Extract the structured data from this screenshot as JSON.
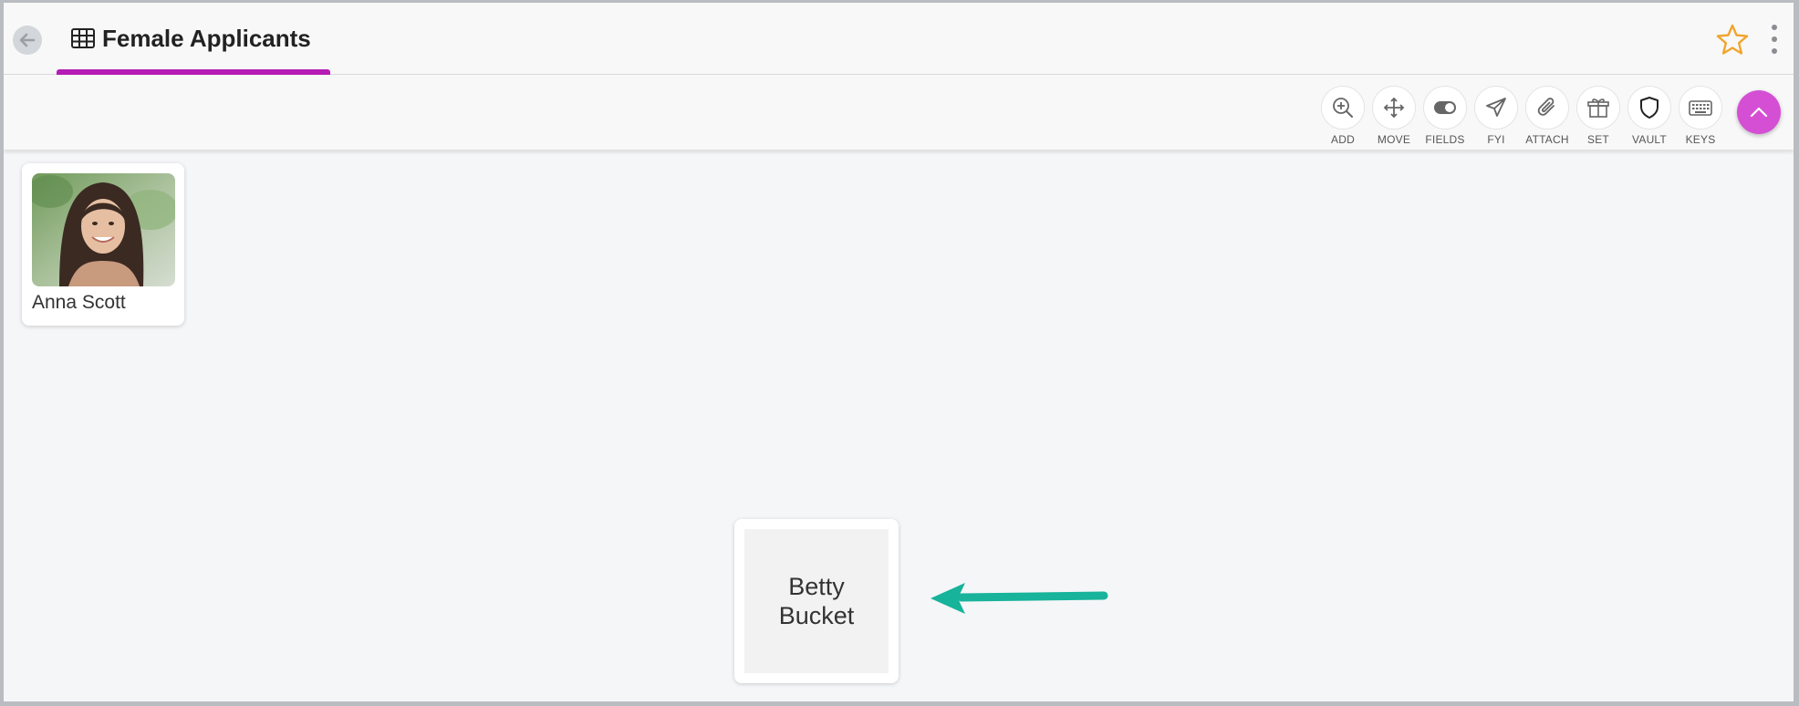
{
  "header": {
    "title": "Female Applicants",
    "accent_color": "#b51bb5",
    "star_color": "#f0a52c"
  },
  "toolbar": {
    "tools": [
      {
        "label": "ADD",
        "icon": "zoom-in-icon"
      },
      {
        "label": "MOVE",
        "icon": "move-icon"
      },
      {
        "label": "FIELDS",
        "icon": "toggle-icon"
      },
      {
        "label": "FYI",
        "icon": "paper-plane-icon"
      },
      {
        "label": "ATTACH",
        "icon": "paperclip-icon"
      },
      {
        "label": "SET",
        "icon": "gift-box-icon"
      },
      {
        "label": "VAULT",
        "icon": "shield-icon"
      },
      {
        "label": "KEYS",
        "icon": "keyboard-icon"
      }
    ],
    "fab_color": "#d44fd4"
  },
  "cards": {
    "anna": {
      "name": "Anna Scott"
    },
    "betty": {
      "name": "Betty Bucket"
    }
  },
  "annotation": {
    "arrow_color": "#17b39a"
  }
}
